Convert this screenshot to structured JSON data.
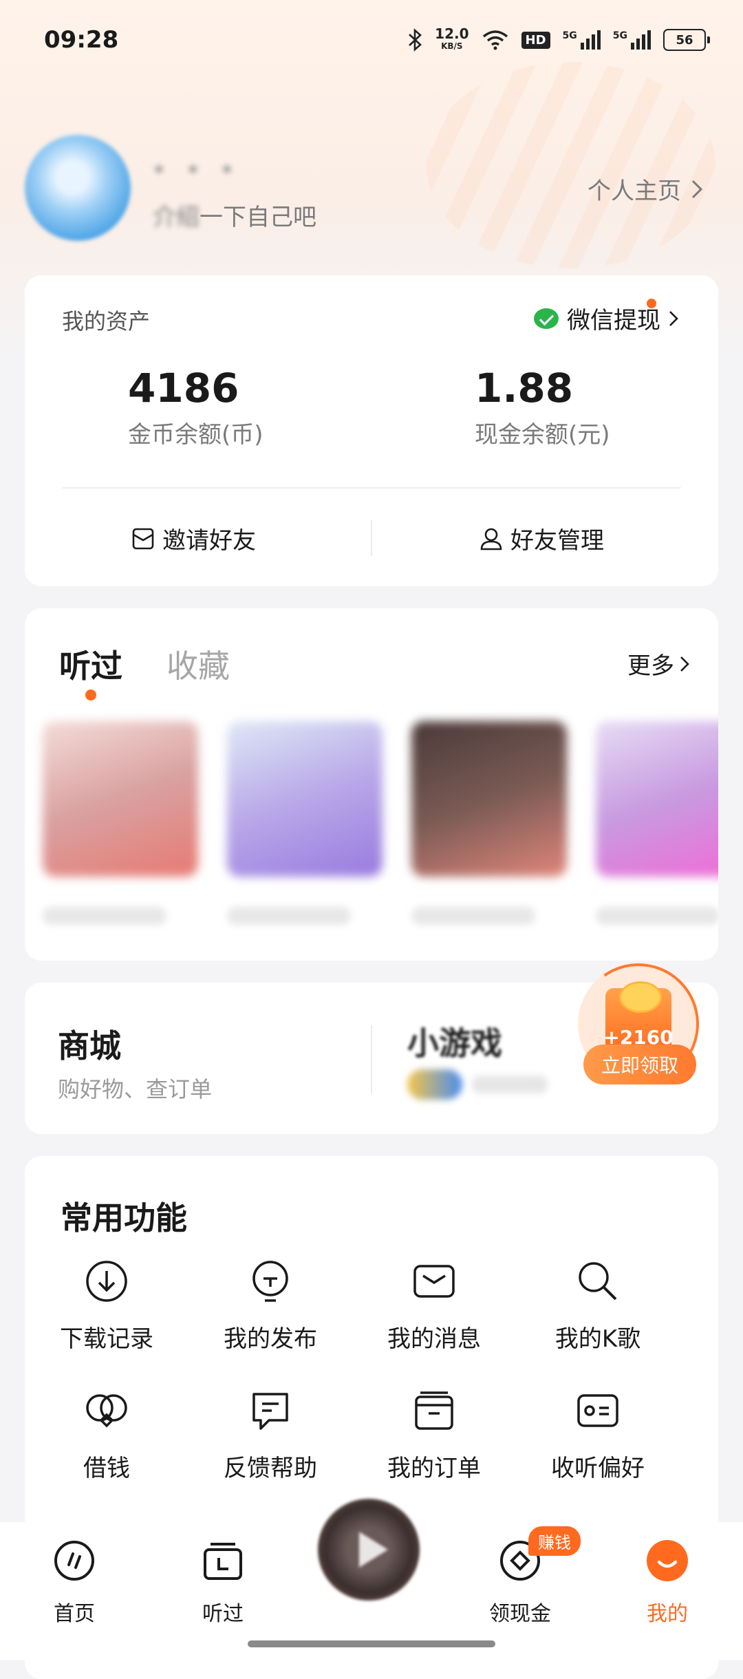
{
  "status_bar": {
    "time": "09:28",
    "speed_value": "12.0",
    "speed_unit": "KB/S",
    "hd": "HD",
    "sig1": "5G",
    "sig2": "5G",
    "battery": "56"
  },
  "profile": {
    "name": "* * *",
    "bio_hidden": "介绍",
    "bio_visible": "一下自己吧",
    "homepage_link": "个人主页"
  },
  "assets": {
    "title": "我的资产",
    "withdraw_label": "微信提现",
    "coin_value": "4186",
    "coin_label": "金币余额(币)",
    "cash_value": "1.88",
    "cash_label": "现金余额(元)",
    "invite_label": "邀请好友",
    "friends_label": "好友管理"
  },
  "history": {
    "tabs": [
      "听过",
      "收藏"
    ],
    "more_label": "更多",
    "items": [
      {
        "colors": [
          "#f3dcd8",
          "#d9a0a0",
          "#e87a72"
        ]
      },
      {
        "colors": [
          "#dfe8f6",
          "#b8a8e8",
          "#9a7ae0"
        ]
      },
      {
        "colors": [
          "#4a3a38",
          "#7a5a55",
          "#e0867a"
        ]
      },
      {
        "colors": [
          "#e6ddf4",
          "#c89ae0",
          "#f26ad6"
        ]
      }
    ]
  },
  "mall": {
    "title": "商城",
    "subtitle": "购好物、查订单",
    "game_title": "小游戏"
  },
  "reward": {
    "amount": "+2160",
    "button": "立即领取"
  },
  "functions": {
    "title": "常用功能",
    "items": [
      {
        "label": "下载记录",
        "icon": "download-icon"
      },
      {
        "label": "我的发布",
        "icon": "publish-icon"
      },
      {
        "label": "我的消息",
        "icon": "message-icon"
      },
      {
        "label": "我的K歌",
        "icon": "karaoke-icon"
      },
      {
        "label": "借钱",
        "icon": "loan-icon"
      },
      {
        "label": "反馈帮助",
        "icon": "feedback-icon"
      },
      {
        "label": "我的订单",
        "icon": "order-icon"
      },
      {
        "label": "收听偏好",
        "icon": "preference-icon"
      }
    ]
  },
  "nav": {
    "home": "首页",
    "heard": "听过",
    "cash": "领现金",
    "earn_badge": "赚钱",
    "me": "我的",
    "active_color": "#ff6a1f"
  }
}
